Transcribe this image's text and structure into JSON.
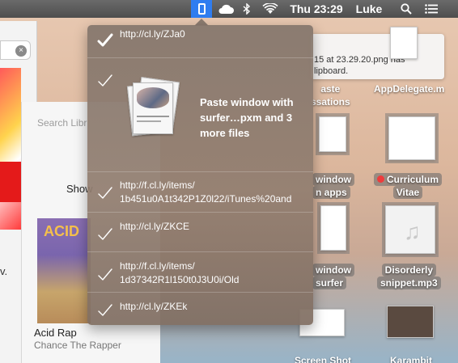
{
  "menubar": {
    "cloudapp_icon": "cloudapp-phone-icon",
    "clock": "Thu 23:29",
    "user": "Luke",
    "icons": [
      "creative-cloud-icon",
      "bluetooth-icon",
      "wifi-icon",
      "spotlight-icon",
      "notification-center-icon"
    ]
  },
  "left_window": {
    "search_clear_symbol": "×",
    "visible_text": "v."
  },
  "itunes": {
    "search_placeholder": "Search Libr",
    "show_label": "Show",
    "album_title": "ACID",
    "album_name": "Acid Rap",
    "album_artist": "Chance The Rapper"
  },
  "notification": {
    "line1": "15 at 23.29.20.png has",
    "line2": "lipboard."
  },
  "desktop": {
    "icons": [
      {
        "label": "AppDelegate.m"
      },
      {
        "label_line1": "aste",
        "label_line2": "ssations"
      },
      {
        "label_line1": "window",
        "label_line2": "n apps"
      },
      {
        "label_line1": "Curriculum",
        "label_line2": "Vitae",
        "tag_color": "#ee3c3c"
      },
      {
        "label_line1": "window",
        "label_line2": "surfer"
      },
      {
        "label_line1": "Disorderly",
        "label_line2": "snippet.mp3"
      },
      {
        "label": "Screen Shot"
      },
      {
        "label": "Karambit"
      }
    ]
  },
  "dropdown": {
    "items": [
      {
        "url": "http://cl.ly/ZJa0",
        "checked_current": true
      },
      {
        "text_line1": "Paste window with",
        "text_line2": "surfer…pxm and 3",
        "text_line3": "more files"
      },
      {
        "url_line1": "http://f.cl.ly/items/",
        "url_line2": "1b451u0A1t342P1Z0l22/iTunes%20and"
      },
      {
        "url": "http://cl.ly/ZKCE"
      },
      {
        "url_line1": "http://f.cl.ly/items/",
        "url_line2": "1d37342R1l150t0J3U0i/Old"
      },
      {
        "url": "http://cl.ly/ZKEk"
      }
    ],
    "background": "#8a7568"
  }
}
